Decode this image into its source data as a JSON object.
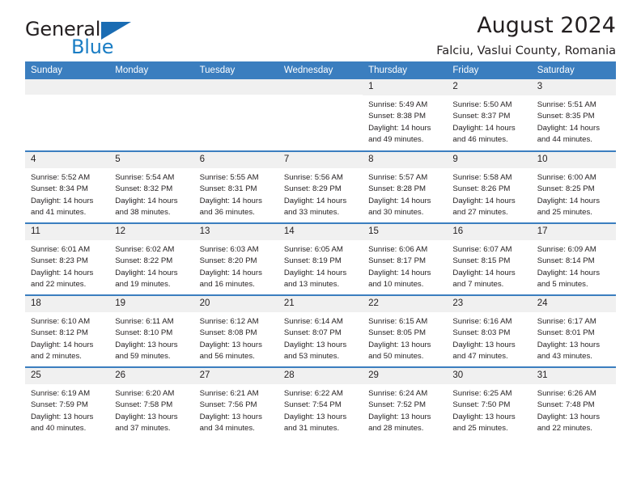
{
  "brand": {
    "name_part1": "General",
    "name_part2": "Blue",
    "triangle_color": "#1a6cb3",
    "blue_color": "#1a7dc4"
  },
  "header": {
    "title": "August 2024",
    "subtitle": "Falciu, Vaslui County, Romania"
  },
  "theme": {
    "header_blue": "#3b7ebf",
    "daynum_bg": "#f0f0f0",
    "text": "#231f20"
  },
  "calendar": {
    "day_headers": [
      "Sunday",
      "Monday",
      "Tuesday",
      "Wednesday",
      "Thursday",
      "Friday",
      "Saturday"
    ],
    "weeks": [
      [
        {
          "day": "",
          "blank": true
        },
        {
          "day": "",
          "blank": true
        },
        {
          "day": "",
          "blank": true
        },
        {
          "day": "",
          "blank": true
        },
        {
          "day": "1",
          "sunrise": "Sunrise: 5:49 AM",
          "sunset": "Sunset: 8:38 PM",
          "daylight": "Daylight: 14 hours and 49 minutes."
        },
        {
          "day": "2",
          "sunrise": "Sunrise: 5:50 AM",
          "sunset": "Sunset: 8:37 PM",
          "daylight": "Daylight: 14 hours and 46 minutes."
        },
        {
          "day": "3",
          "sunrise": "Sunrise: 5:51 AM",
          "sunset": "Sunset: 8:35 PM",
          "daylight": "Daylight: 14 hours and 44 minutes."
        }
      ],
      [
        {
          "day": "4",
          "sunrise": "Sunrise: 5:52 AM",
          "sunset": "Sunset: 8:34 PM",
          "daylight": "Daylight: 14 hours and 41 minutes."
        },
        {
          "day": "5",
          "sunrise": "Sunrise: 5:54 AM",
          "sunset": "Sunset: 8:32 PM",
          "daylight": "Daylight: 14 hours and 38 minutes."
        },
        {
          "day": "6",
          "sunrise": "Sunrise: 5:55 AM",
          "sunset": "Sunset: 8:31 PM",
          "daylight": "Daylight: 14 hours and 36 minutes."
        },
        {
          "day": "7",
          "sunrise": "Sunrise: 5:56 AM",
          "sunset": "Sunset: 8:29 PM",
          "daylight": "Daylight: 14 hours and 33 minutes."
        },
        {
          "day": "8",
          "sunrise": "Sunrise: 5:57 AM",
          "sunset": "Sunset: 8:28 PM",
          "daylight": "Daylight: 14 hours and 30 minutes."
        },
        {
          "day": "9",
          "sunrise": "Sunrise: 5:58 AM",
          "sunset": "Sunset: 8:26 PM",
          "daylight": "Daylight: 14 hours and 27 minutes."
        },
        {
          "day": "10",
          "sunrise": "Sunrise: 6:00 AM",
          "sunset": "Sunset: 8:25 PM",
          "daylight": "Daylight: 14 hours and 25 minutes."
        }
      ],
      [
        {
          "day": "11",
          "sunrise": "Sunrise: 6:01 AM",
          "sunset": "Sunset: 8:23 PM",
          "daylight": "Daylight: 14 hours and 22 minutes."
        },
        {
          "day": "12",
          "sunrise": "Sunrise: 6:02 AM",
          "sunset": "Sunset: 8:22 PM",
          "daylight": "Daylight: 14 hours and 19 minutes."
        },
        {
          "day": "13",
          "sunrise": "Sunrise: 6:03 AM",
          "sunset": "Sunset: 8:20 PM",
          "daylight": "Daylight: 14 hours and 16 minutes."
        },
        {
          "day": "14",
          "sunrise": "Sunrise: 6:05 AM",
          "sunset": "Sunset: 8:19 PM",
          "daylight": "Daylight: 14 hours and 13 minutes."
        },
        {
          "day": "15",
          "sunrise": "Sunrise: 6:06 AM",
          "sunset": "Sunset: 8:17 PM",
          "daylight": "Daylight: 14 hours and 10 minutes."
        },
        {
          "day": "16",
          "sunrise": "Sunrise: 6:07 AM",
          "sunset": "Sunset: 8:15 PM",
          "daylight": "Daylight: 14 hours and 7 minutes."
        },
        {
          "day": "17",
          "sunrise": "Sunrise: 6:09 AM",
          "sunset": "Sunset: 8:14 PM",
          "daylight": "Daylight: 14 hours and 5 minutes."
        }
      ],
      [
        {
          "day": "18",
          "sunrise": "Sunrise: 6:10 AM",
          "sunset": "Sunset: 8:12 PM",
          "daylight": "Daylight: 14 hours and 2 minutes."
        },
        {
          "day": "19",
          "sunrise": "Sunrise: 6:11 AM",
          "sunset": "Sunset: 8:10 PM",
          "daylight": "Daylight: 13 hours and 59 minutes."
        },
        {
          "day": "20",
          "sunrise": "Sunrise: 6:12 AM",
          "sunset": "Sunset: 8:08 PM",
          "daylight": "Daylight: 13 hours and 56 minutes."
        },
        {
          "day": "21",
          "sunrise": "Sunrise: 6:14 AM",
          "sunset": "Sunset: 8:07 PM",
          "daylight": "Daylight: 13 hours and 53 minutes."
        },
        {
          "day": "22",
          "sunrise": "Sunrise: 6:15 AM",
          "sunset": "Sunset: 8:05 PM",
          "daylight": "Daylight: 13 hours and 50 minutes."
        },
        {
          "day": "23",
          "sunrise": "Sunrise: 6:16 AM",
          "sunset": "Sunset: 8:03 PM",
          "daylight": "Daylight: 13 hours and 47 minutes."
        },
        {
          "day": "24",
          "sunrise": "Sunrise: 6:17 AM",
          "sunset": "Sunset: 8:01 PM",
          "daylight": "Daylight: 13 hours and 43 minutes."
        }
      ],
      [
        {
          "day": "25",
          "sunrise": "Sunrise: 6:19 AM",
          "sunset": "Sunset: 7:59 PM",
          "daylight": "Daylight: 13 hours and 40 minutes."
        },
        {
          "day": "26",
          "sunrise": "Sunrise: 6:20 AM",
          "sunset": "Sunset: 7:58 PM",
          "daylight": "Daylight: 13 hours and 37 minutes."
        },
        {
          "day": "27",
          "sunrise": "Sunrise: 6:21 AM",
          "sunset": "Sunset: 7:56 PM",
          "daylight": "Daylight: 13 hours and 34 minutes."
        },
        {
          "day": "28",
          "sunrise": "Sunrise: 6:22 AM",
          "sunset": "Sunset: 7:54 PM",
          "daylight": "Daylight: 13 hours and 31 minutes."
        },
        {
          "day": "29",
          "sunrise": "Sunrise: 6:24 AM",
          "sunset": "Sunset: 7:52 PM",
          "daylight": "Daylight: 13 hours and 28 minutes."
        },
        {
          "day": "30",
          "sunrise": "Sunrise: 6:25 AM",
          "sunset": "Sunset: 7:50 PM",
          "daylight": "Daylight: 13 hours and 25 minutes."
        },
        {
          "day": "31",
          "sunrise": "Sunrise: 6:26 AM",
          "sunset": "Sunset: 7:48 PM",
          "daylight": "Daylight: 13 hours and 22 minutes."
        }
      ]
    ]
  }
}
